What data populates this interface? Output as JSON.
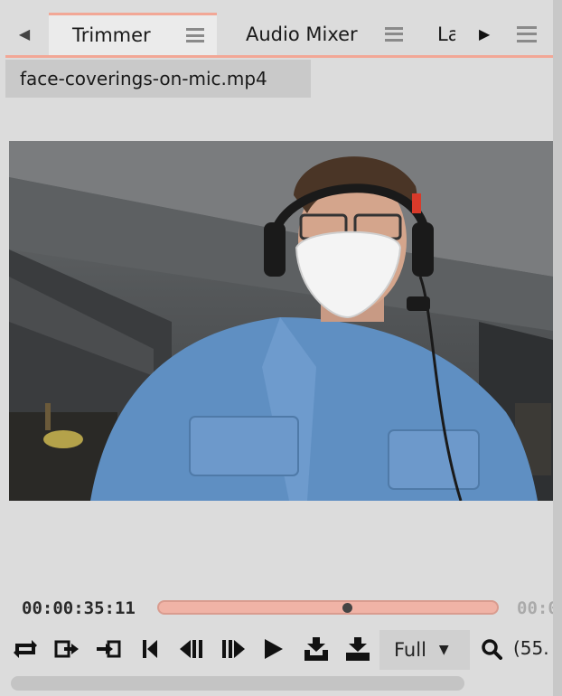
{
  "tabs": {
    "items": [
      {
        "label": "Trimmer"
      },
      {
        "label": "Audio Mixer"
      },
      {
        "label": "La"
      }
    ]
  },
  "clip": {
    "filename": "face-coverings-on-mic.mp4"
  },
  "transport": {
    "current_time": "00:00:35:11",
    "end_time": "00:0",
    "playhead_fraction": 0.56
  },
  "zoom": {
    "mode": "Full",
    "value": "(55."
  },
  "icons": {
    "tab_left": "chevron-left-icon",
    "tab_right": "chevron-right-icon",
    "loop": "loop-icon",
    "mark_out_clip": "export-icon",
    "mark_in": "enter-icon",
    "prev": "skip-back-icon",
    "step_back": "frame-back-icon",
    "step_forward": "frame-forward-icon",
    "play": "play-icon",
    "insert": "insert-down-icon",
    "overwrite": "overwrite-down-icon",
    "zoom": "magnifier-icon"
  },
  "colors": {
    "accent": "#f2a796"
  }
}
